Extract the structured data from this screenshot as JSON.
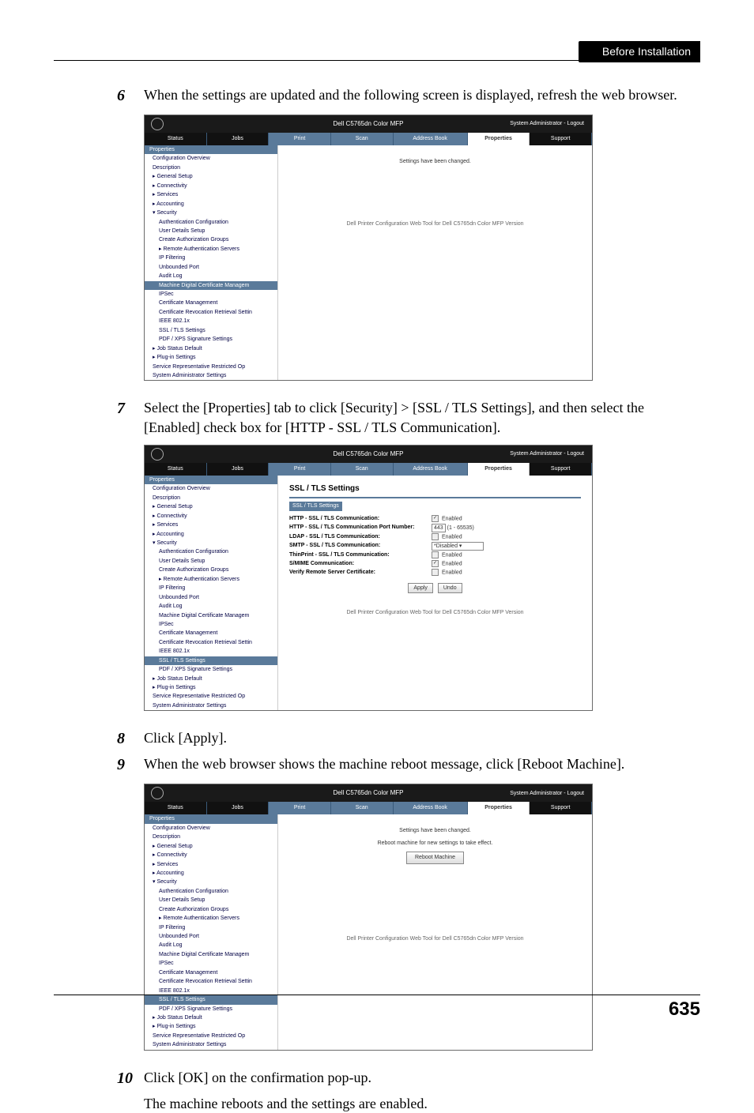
{
  "header": {
    "section": "Before Installation"
  },
  "page_number": "635",
  "steps": {
    "s6": {
      "num": "6",
      "text": "When the settings are updated and the following screen is displayed, refresh the web browser."
    },
    "s7": {
      "num": "7",
      "text": "Select the [Properties] tab to click [Security] > [SSL / TLS Settings], and then select the [Enabled] check box for [HTTP - SSL / TLS Communication]."
    },
    "s8": {
      "num": "8",
      "text": "Click [Apply]."
    },
    "s9": {
      "num": "9",
      "text": "When the web browser shows the machine reboot message, click [Reboot Machine]."
    },
    "s10": {
      "num": "10",
      "text": "Click [OK] on the confirmation pop-up."
    },
    "s10b": "The machine reboots and the settings are enabled."
  },
  "shot_common": {
    "title": "Dell C5765dn Color MFP",
    "topright": "System Administrator - Logout",
    "tabs_black": [
      "Status",
      "Jobs"
    ],
    "tabs_blue": [
      "Print",
      "Scan",
      "Address Book"
    ],
    "tabs_right": [
      "Properties",
      "Support"
    ],
    "side_header": "Properties",
    "footer": "Dell Printer Configuration Web Tool for Dell C5765dn Color MFP Version",
    "side_items": [
      "Configuration Overview",
      "Description",
      "▸ General Setup",
      "▸ Connectivity",
      "▸ Services",
      "▸ Accounting",
      "▾ Security"
    ],
    "side_sec": [
      "Authentication Configuration",
      "User Details Setup",
      "Create Authorization Groups",
      "▸ Remote Authentication Servers",
      "IP Filtering",
      "Unbounded Port",
      "Audit Log",
      "Machine Digital Certificate Managem",
      "IPSec",
      "Certificate Management",
      "Certificate Revocation Retrieval Settin",
      "IEEE 802.1x",
      "SSL / TLS Settings",
      "PDF / XPS Signature Settings"
    ],
    "side_after": [
      "▸ Job Status Default",
      "▸ Plug-in Settings",
      "Service Representative Restricted Op",
      "System Administrator Settings"
    ]
  },
  "shot1": {
    "main_msg": "Settings have been changed.",
    "highlight": "Machine Digital Certificate Managem"
  },
  "shot2": {
    "heading": "SSL / TLS Settings",
    "section_bar": "SSL / TLS Settings",
    "fields": [
      {
        "k": "HTTP - SSL / TLS Communication:",
        "v_type": "check",
        "v_label": "Enabled",
        "checked": true
      },
      {
        "k": "HTTP - SSL / TLS Communication Port Number:",
        "v_type": "input",
        "v": "443",
        "v_note": "(1 - 65535)"
      },
      {
        "k": "LDAP - SSL / TLS Communication:",
        "v_type": "check",
        "v_label": "Enabled",
        "checked": false
      },
      {
        "k": "SMTP - SSL / TLS Communication:",
        "v_type": "select",
        "v": "*Disabled"
      },
      {
        "k": "ThinPrint - SSL / TLS Communication:",
        "v_type": "check",
        "v_label": "Enabled",
        "checked": false
      },
      {
        "k": "S/MIME Communication:",
        "v_type": "check",
        "v_label": "Enabled",
        "checked": true
      },
      {
        "k": "Verify Remote Server Certificate:",
        "v_type": "check",
        "v_label": "Enabled",
        "checked": false
      }
    ],
    "buttons": [
      "Apply",
      "Undo"
    ],
    "highlight": "SSL / TLS Settings"
  },
  "shot3": {
    "main_msg": "Settings have been changed.",
    "main_msg2": "Reboot machine for new settings to take effect.",
    "button": "Reboot Machine",
    "highlight": "SSL / TLS Settings"
  }
}
